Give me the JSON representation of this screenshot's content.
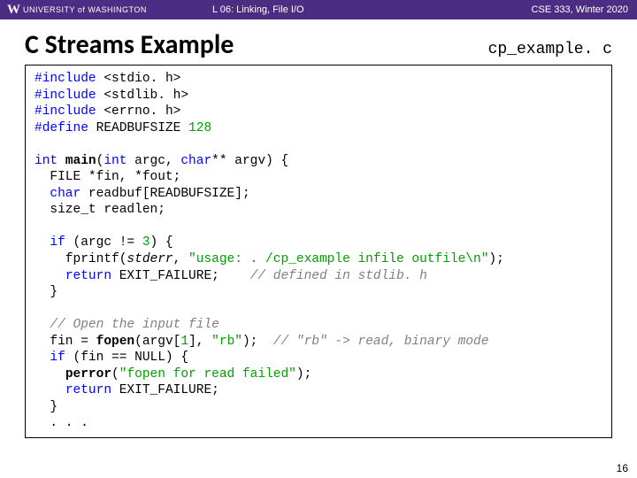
{
  "topbar": {
    "uw_w": "W",
    "uw_text": "UNIVERSITY of WASHINGTON",
    "lecture": "L 06: Linking, File I/O",
    "course": "CSE 333, Winter 2020"
  },
  "title": "C Streams Example",
  "filename": "cp_example. c",
  "code": {
    "l01_a": "#include",
    "l01_b": " <stdio. h>",
    "l02_a": "#include",
    "l02_b": " <stdlib. h>",
    "l03_a": "#include",
    "l03_b": " <errno. h>",
    "l04_a": "#define",
    "l04_b": " READBUFSIZE ",
    "l04_c": "128",
    "l05": "",
    "l06_a": "int",
    "l06_b": " ",
    "l06_c": "main",
    "l06_d": "(",
    "l06_e": "int",
    "l06_f": " argc, ",
    "l06_g": "char",
    "l06_h": "** argv) {",
    "l07": "  FILE *fin, *fout;",
    "l08_a": "  ",
    "l08_b": "char",
    "l08_c": " readbuf[READBUFSIZE];",
    "l09": "  size_t readlen;",
    "l10": "",
    "l11_a": "  ",
    "l11_b": "if",
    "l11_c": " (argc != ",
    "l11_d": "3",
    "l11_e": ") {",
    "l12_a": "    fprintf(",
    "l12_b": "stderr",
    "l12_c": ", ",
    "l12_d": "\"usage: . /cp_example infile outfile\\n\"",
    "l12_e": ");",
    "l13_a": "    ",
    "l13_b": "return",
    "l13_c": " EXIT_FAILURE;    ",
    "l13_d": "// defined in stdlib. h",
    "l14": "  }",
    "l15": "",
    "l16": "  // Open the input file",
    "l17_a": "  fin = ",
    "l17_b": "fopen",
    "l17_c": "(argv[",
    "l17_d": "1",
    "l17_e": "], ",
    "l17_f": "\"rb\"",
    "l17_g": ");  ",
    "l17_h": "// \"rb\" -> read, binary mode",
    "l18_a": "  ",
    "l18_b": "if",
    "l18_c": " (fin == NULL) {",
    "l19_a": "    ",
    "l19_b": "perror",
    "l19_c": "(",
    "l19_d": "\"fopen for read failed\"",
    "l19_e": ");",
    "l20_a": "    ",
    "l20_b": "return",
    "l20_c": " EXIT_FAILURE;",
    "l21": "  }",
    "l22": "  . . ."
  },
  "pagenum": "16"
}
